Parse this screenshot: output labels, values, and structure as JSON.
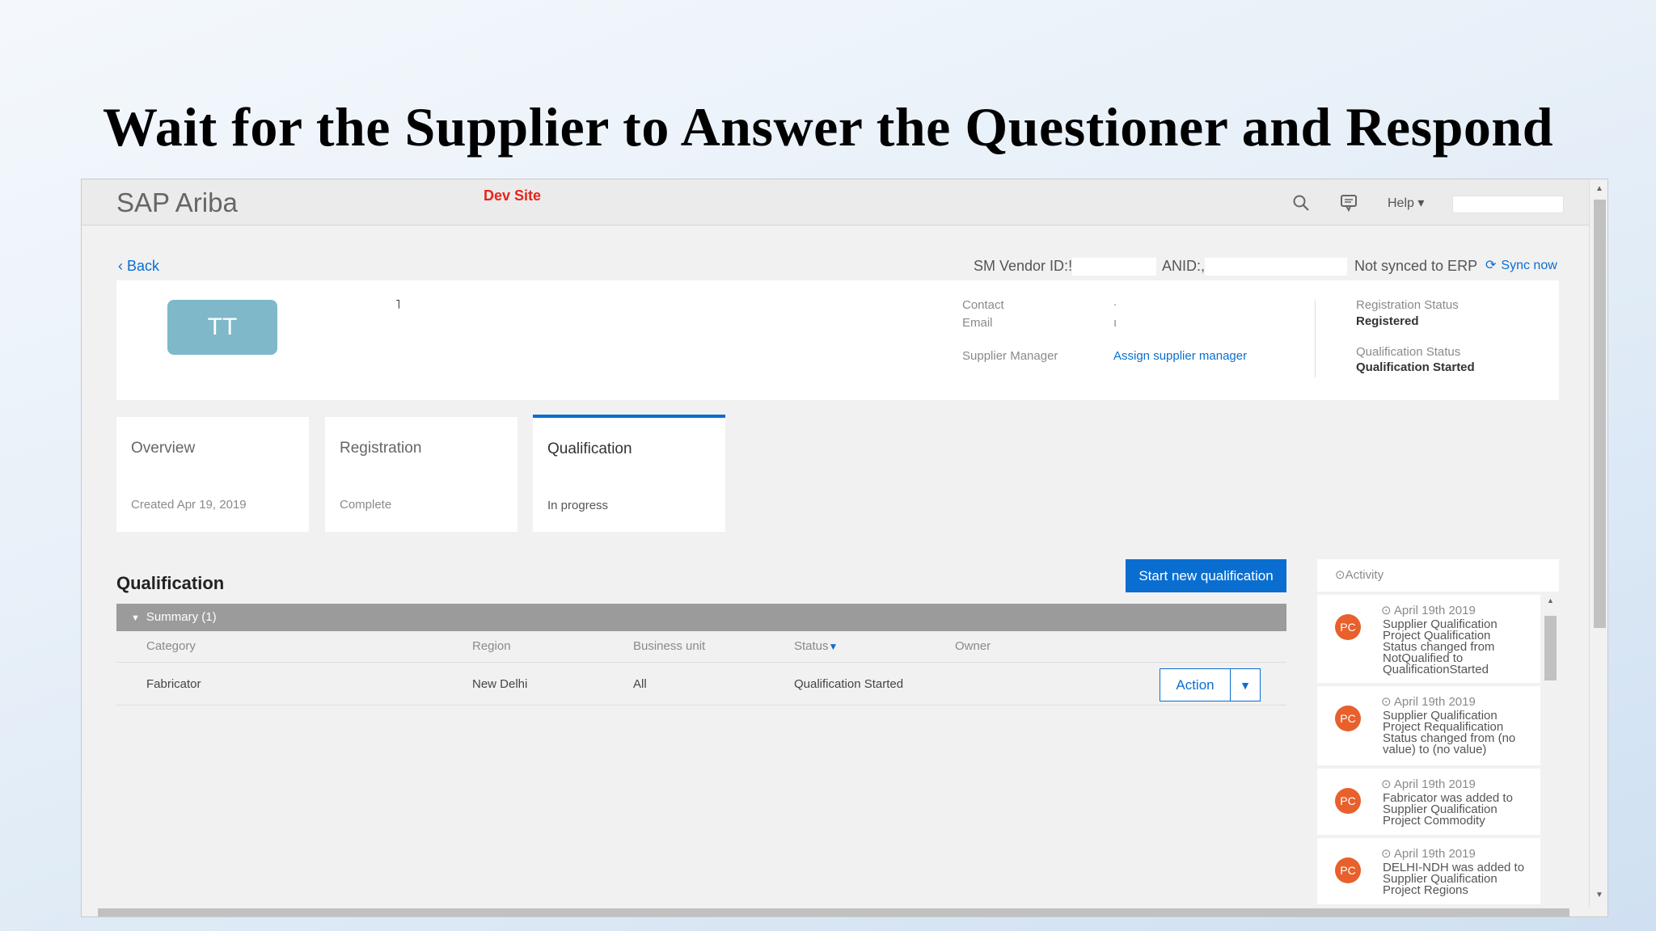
{
  "slide": {
    "title": "Wait for the Supplier to Answer the Questioner and Respond"
  },
  "header": {
    "logo": "SAP Ariba",
    "dev_site": "Dev Site",
    "help": "Help ▾",
    "search_icon": "search-icon",
    "chat_icon": "chat-icon"
  },
  "nav": {
    "back": "‹ Back",
    "sm_vendor_label": "SM Vendor ID:",
    "sm_vendor_prefix": "!",
    "anid_label": "ANID:",
    "anid_prefix": ",",
    "erp_status": "Not synced to ERP",
    "sync_now": "Sync now"
  },
  "supplier": {
    "initials": "TT",
    "mark": "˥",
    "contact_label": "Contact",
    "contact_value": ".",
    "email_label": "Email",
    "email_value": "ı",
    "manager_label": "Supplier Manager",
    "manager_link": "Assign supplier manager",
    "registration_status_label": "Registration Status",
    "registration_status_value": "Registered",
    "qualification_status_label": "Qualification Status",
    "qualification_status_value": "Qualification Started"
  },
  "tiles": [
    {
      "title": "Overview",
      "subtitle": "Created  Apr 19, 2019"
    },
    {
      "title": "Registration",
      "subtitle": "Complete"
    },
    {
      "title": "Qualification",
      "subtitle": "In progress"
    }
  ],
  "qualification": {
    "heading": "Qualification",
    "start_button": "Start new qualification",
    "summary": "Summary (1)",
    "columns": [
      "Category",
      "Region",
      "Business unit",
      "Status",
      "Owner"
    ],
    "rows": [
      {
        "category": "Fabricator",
        "region": "New Delhi",
        "business_unit": "All",
        "status": "Qualification Started",
        "owner": ""
      }
    ],
    "action_button": "Action"
  },
  "activity": {
    "title": "Activity",
    "items": [
      {
        "avatar": "PC",
        "date": "April 19th 2019",
        "lines": [
          "Supplier Qualification",
          "Project Qualification",
          "Status changed from",
          "NotQualified to",
          "QualificationStarted"
        ]
      },
      {
        "avatar": "PC",
        "date": "April 19th 2019",
        "lines": [
          "Supplier Qualification",
          "Project Requalification",
          "Status changed from (no",
          "value) to (no value)"
        ]
      },
      {
        "avatar": "PC",
        "date": "April 19th 2019",
        "lines": [
          "Fabricator was added to",
          "Supplier Qualification",
          "Project Commodity"
        ]
      },
      {
        "avatar": "PC",
        "date": "April 19th 2019",
        "lines": [
          "DELHI-NDH was added to",
          "Supplier Qualification",
          "Project Regions"
        ]
      }
    ]
  },
  "colors": {
    "accent": "#0a6ed1",
    "dev_site": "#e8231b",
    "avatar_tile": "#7eb8c9",
    "activity_avatar": "#e8602c"
  }
}
